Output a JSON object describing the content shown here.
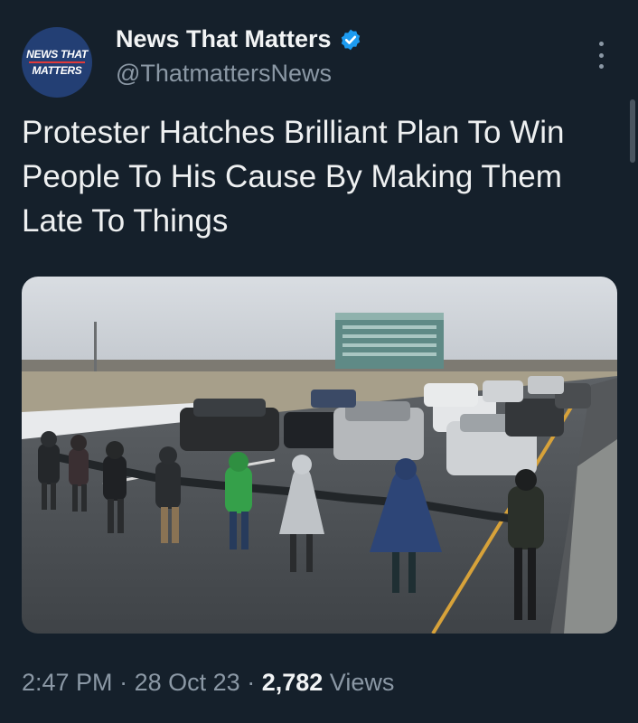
{
  "account": {
    "display_name": "News That Matters",
    "handle": "@ThatmattersNews",
    "avatar_text_line1": "NEWS THAT",
    "avatar_text_line2": "MATTERS",
    "verified": true
  },
  "tweet": {
    "text": "Protester Hatches Brilliant Plan To Win People To His Cause By Making Them Late To Things",
    "time": "2:47 PM",
    "separator": "·",
    "date": "28 Oct 23",
    "views_count": "2,782",
    "views_label": "Views"
  },
  "icons": {
    "verified": "verified-badge-icon",
    "more": "more-options-icon"
  },
  "colors": {
    "background": "#15202b",
    "verified": "#1d9bf0",
    "secondary_text": "#8b98a5"
  }
}
